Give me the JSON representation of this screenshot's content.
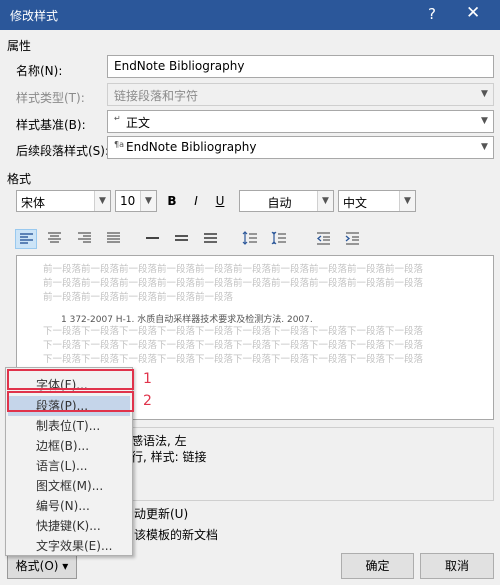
{
  "window": {
    "title": "修改样式",
    "help": "?",
    "close": "✕"
  },
  "properties": {
    "section": "属性",
    "name_label": "名称(N):",
    "name_value": "EndNote Bibliography",
    "type_label": "样式类型(T):",
    "type_value": "链接段落和字符",
    "based_label": "样式基准(B):",
    "based_value": "正文",
    "next_label": "后续段落样式(S):",
    "next_value": "EndNote Bibliography"
  },
  "format": {
    "section": "格式",
    "font": "宋体",
    "size": "10",
    "bold": "B",
    "italic": "I",
    "underline": "U",
    "color": "自动",
    "script": "中文"
  },
  "preview": {
    "prev_line1": "前一段落前一段落前一段落前一段落前一段落前一段落前一段落前一段落前一段落前一段落",
    "prev_line2": "前一段落前一段落前一段落前一段落前一段落前一段落前一段落前一段落前一段落前一段落",
    "prev_line3": "前一段落前一段落前一段落前一段落前一段落",
    "sample": "1      372-2007 H-1. 水质自动采样器技术要求及检测方法. 2007.",
    "next_line1": "下一段落下一段落下一段落下一段落下一段落下一段落下一段落下一段落下一段落下一段落",
    "next_line2": "下一段落下一段落下一段落下一段落下一段落下一段落下一段落下一段落下一段落下一段落",
    "next_line3": "下一段落下一段落下一段落下一段落下一段落下一段落下一段落下一段落下一段落下一段落"
  },
  "description": {
    "line1": "感语法, 左",
    "line2": "行, 样式: 链接"
  },
  "options": {
    "auto_update": "动更新(U)",
    "template": "该模板的新文档"
  },
  "buttons": {
    "format": "格式(O) ▾",
    "ok": "确定",
    "cancel": "取消"
  },
  "menu": {
    "items": [
      "字体(F)...",
      "段落(P)...",
      "制表位(T)...",
      "边框(B)...",
      "语言(L)...",
      "图文框(M)...",
      "编号(N)...",
      "快捷键(K)...",
      "文字效果(E)..."
    ]
  },
  "annotations": {
    "n1": "1",
    "n2": "2",
    "color": "#e0334b"
  }
}
